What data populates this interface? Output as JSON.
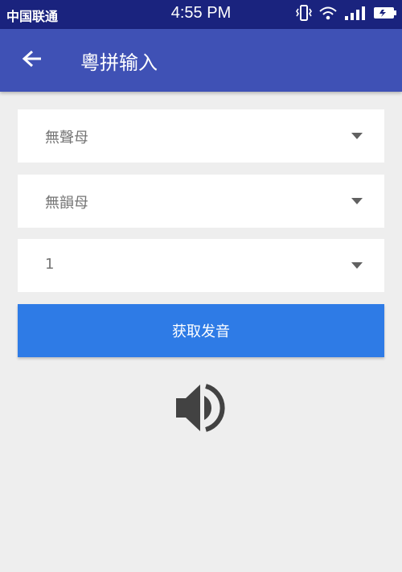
{
  "status_bar": {
    "carrier": "中国联通",
    "time": "4:55 PM",
    "icons": [
      "vibrate-icon",
      "wifi-icon",
      "signal-icon",
      "battery-icon"
    ]
  },
  "app_bar": {
    "back_icon": "arrow-back-icon",
    "title": "粵拼输入",
    "color": "#3f51b5"
  },
  "form": {
    "initial_select": {
      "selected": "無聲母"
    },
    "final_select": {
      "selected": "無韻母"
    },
    "tone_select": {
      "selected": "1"
    },
    "submit_label": "获取发音",
    "button_color": "#2e7be6"
  },
  "speaker": {
    "icon": "volume-icon"
  }
}
